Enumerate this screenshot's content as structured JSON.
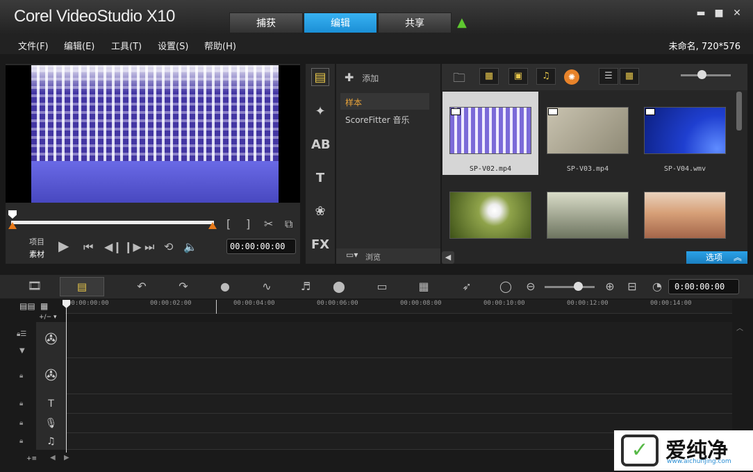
{
  "app": {
    "logo": "Corel VideoStudio X10"
  },
  "tabs": [
    {
      "label": "捕获"
    },
    {
      "label": "编辑"
    },
    {
      "label": "共享"
    }
  ],
  "window": {
    "minimize": "▬",
    "maximize": "■",
    "close": "✕"
  },
  "menu": [
    {
      "label": "文件(F)"
    },
    {
      "label": "编辑(E)"
    },
    {
      "label": "工具(T)"
    },
    {
      "label": "设置(S)"
    },
    {
      "label": "帮助(H)"
    }
  ],
  "project_info": "未命名, 720*576",
  "player": {
    "mode_project": "项目",
    "mode_clip": "素材",
    "mark_in": "[",
    "mark_out": "]",
    "timecode": "00:00:00:00"
  },
  "library": {
    "add_label": "添加",
    "folders": [
      {
        "label": "样本"
      },
      {
        "label": "ScoreFitter 音乐"
      }
    ],
    "browse_label": "浏览",
    "thumbnails": [
      {
        "caption": "SP-V02.mp4",
        "color_a": "#7b6ad8",
        "color_b": "#f0ecff"
      },
      {
        "caption": "SP-V03.mp4",
        "color_a": "#c9c3b0",
        "color_b": "#8f8a76"
      },
      {
        "caption": "SP-V04.wmv",
        "color_a": "#1f3fd0",
        "color_b": "#0c1f80"
      },
      {
        "caption": "",
        "color_a": "#8fa34a",
        "color_b": "#3e5218"
      },
      {
        "caption": "",
        "color_a": "#d9dcc8",
        "color_b": "#6e7560"
      },
      {
        "caption": "",
        "color_a": "#d7a078",
        "color_b": "#a4664a"
      }
    ],
    "options_label": "选项"
  },
  "timeline": {
    "timecode": "0:00:00:00",
    "ruler": [
      "00:00:00:00",
      "00:00:02:00",
      "00:00:04:00",
      "00:00:06:00",
      "00:00:08:00",
      "00:00:10:00",
      "00:00:12:00",
      "00:00:14:00"
    ]
  },
  "watermark": {
    "brand": "爱纯净",
    "url": "www.aichunjing.com"
  },
  "colors": {
    "accent": "#1b8fd6",
    "marker": "#e87a1a"
  }
}
